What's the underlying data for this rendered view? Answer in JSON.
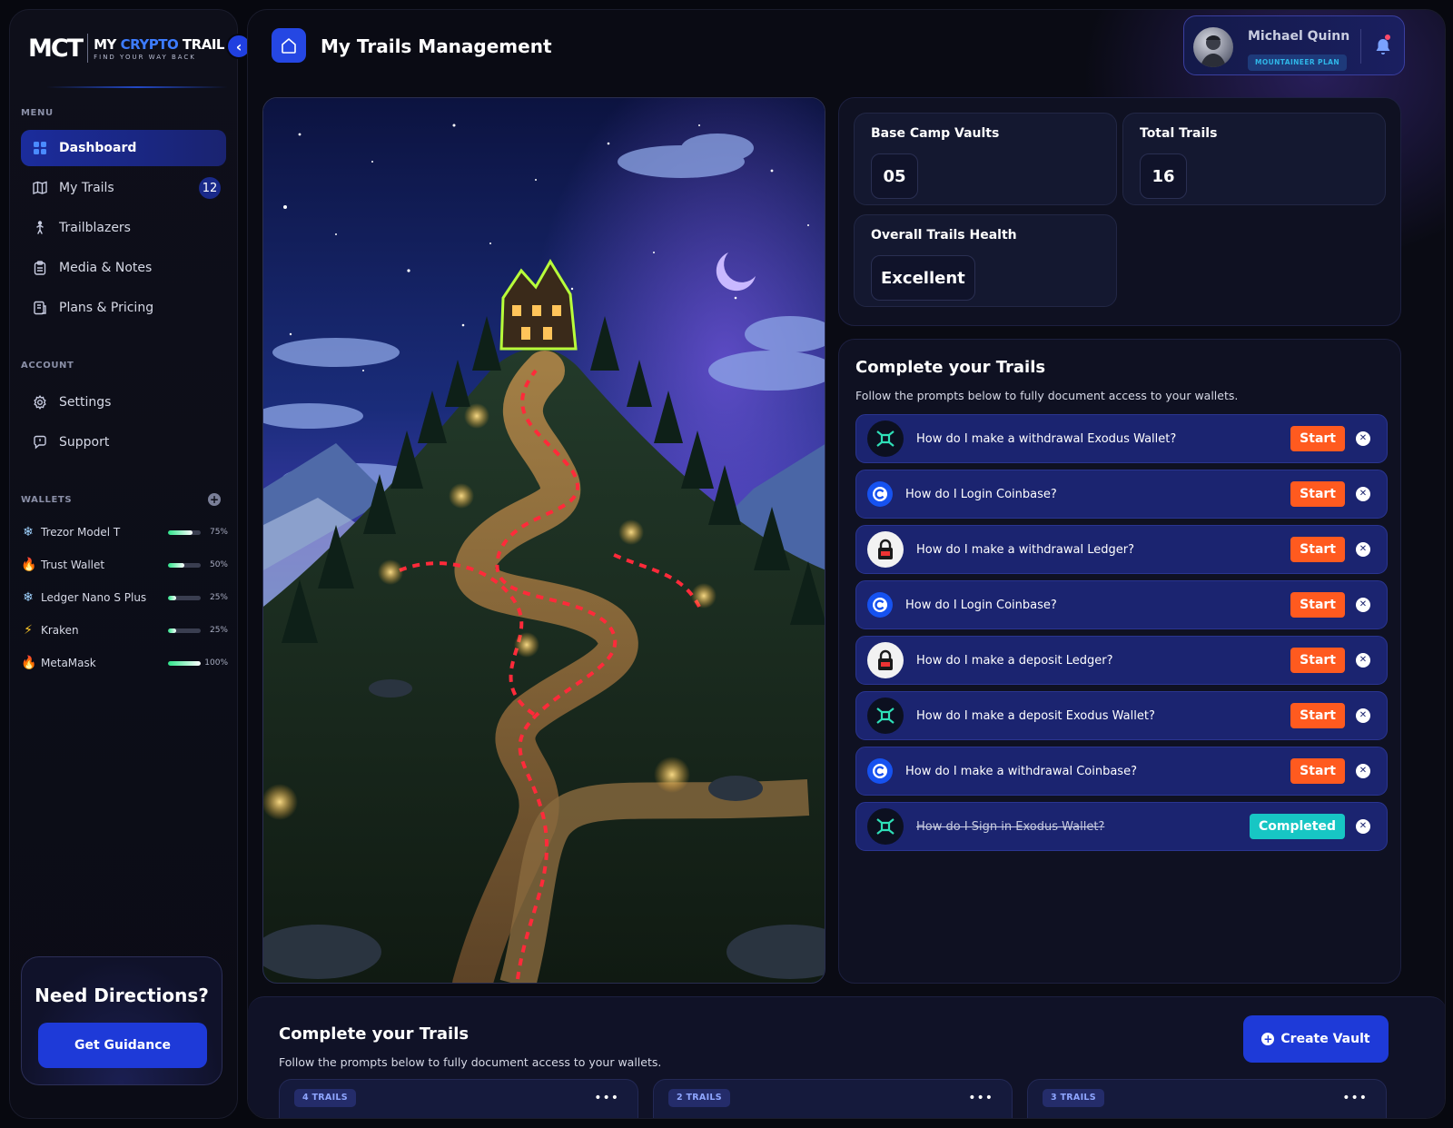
{
  "brand": {
    "mark": "MCT",
    "title_prefix": "MY ",
    "title_accent": "CRYPTO",
    "title_suffix": " TRAIL",
    "tagline": "FIND YOUR WAY BACK"
  },
  "sidebar": {
    "menu_label": "MENU",
    "menu_items": [
      {
        "label": "Dashboard",
        "icon": "grid-icon",
        "active": true
      },
      {
        "label": "My Trails",
        "icon": "map-icon",
        "badge": "12"
      },
      {
        "label": "Trailblazers",
        "icon": "hiker-icon"
      },
      {
        "label": "Media & Notes",
        "icon": "clipboard-icon"
      },
      {
        "label": "Plans & Pricing",
        "icon": "pricing-icon"
      }
    ],
    "account_label": "ACCOUNT",
    "account_items": [
      {
        "label": "Settings",
        "icon": "gear-icon"
      },
      {
        "label": "Support",
        "icon": "chat-icon"
      }
    ],
    "wallets_label": "WALLETS",
    "wallets": [
      {
        "name": "Trezor Model T",
        "icon": "snowflake-icon",
        "progress": 75,
        "pct": "75%"
      },
      {
        "name": "Trust Wallet",
        "icon": "fire-icon",
        "progress": 50,
        "pct": "50%"
      },
      {
        "name": "Ledger Nano S Plus",
        "icon": "snowflake-icon",
        "progress": 25,
        "pct": "25%"
      },
      {
        "name": "Kraken",
        "icon": "lightning-icon",
        "progress": 25,
        "pct": "25%"
      },
      {
        "name": "MetaMask",
        "icon": "fire-icon",
        "progress": 100,
        "pct": "100%"
      }
    ],
    "directions": {
      "title": "Need Directions?",
      "button": "Get Guidance"
    }
  },
  "header": {
    "title": "My Trails Management",
    "user": {
      "name": "Michael Quinn",
      "plan": "MOUNTAINEER PLAN"
    }
  },
  "stats": [
    {
      "label": "Base Camp Vaults",
      "value": "05"
    },
    {
      "label": "Total Trails",
      "value": "16"
    },
    {
      "label": "Overall Trails Health",
      "value": "Excellent"
    }
  ],
  "trails": {
    "title": "Complete your Trails",
    "subtitle": "Follow the prompts below to fully document access to your wallets.",
    "items": [
      {
        "text": "How do I make a withdrawal Exodus Wallet?",
        "logo": "exodus",
        "action": "Start",
        "done": false
      },
      {
        "text": "How do I Login Coinbase?",
        "logo": "coinbase",
        "action": "Start",
        "done": false
      },
      {
        "text": "How do I make a withdrawal Ledger?",
        "logo": "ledger",
        "action": "Start",
        "done": false
      },
      {
        "text": "How do I Login Coinbase?",
        "logo": "coinbase",
        "action": "Start",
        "done": false
      },
      {
        "text": "How do I make a deposit Ledger?",
        "logo": "ledger",
        "action": "Start",
        "done": false
      },
      {
        "text": "How do I make a deposit Exodus Wallet?",
        "logo": "exodus",
        "action": "Start",
        "done": false
      },
      {
        "text": "How do I make a withdrawal Coinbase?",
        "logo": "coinbase",
        "action": "Start",
        "done": false
      },
      {
        "text": "How do I Sign in Exodus Wallet?",
        "logo": "exodus",
        "action": "Completed",
        "done": true
      }
    ]
  },
  "bottom": {
    "title": "Complete your Trails",
    "subtitle": "Follow the prompts below to fully document access to your wallets.",
    "create_button": "Create Vault",
    "vaults": [
      {
        "badge": "4 TRAILS",
        "menu": "•••"
      },
      {
        "badge": "2 TRAILS",
        "menu": "•••"
      },
      {
        "badge": "3 TRAILS",
        "menu": "•••"
      }
    ]
  },
  "colors": {
    "accent": "#1e3ad8",
    "start": "#ff5a1f",
    "completed": "#17c6c4",
    "row": "#1b2470"
  }
}
